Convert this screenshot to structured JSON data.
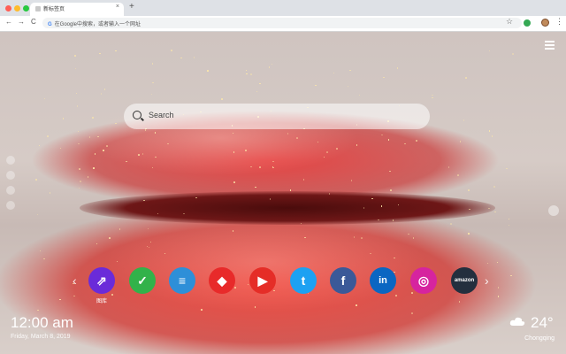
{
  "browser": {
    "tab_title": "新标签页",
    "tab_close": "×",
    "new_tab": "+",
    "address_placeholder": "在Google中搜索，或者输入一个网址",
    "google_glyph": "G",
    "nav": {
      "back": "←",
      "forward": "→",
      "reload": "C"
    },
    "star": "☆",
    "menu": "⋮"
  },
  "search": {
    "placeholder": "Search"
  },
  "apps": [
    {
      "name": "gallery",
      "label": "图库",
      "color": "#6a2bd9",
      "glyph": "⇗"
    },
    {
      "name": "check",
      "label": "",
      "color": "#32b24a",
      "glyph": "✓"
    },
    {
      "name": "notes",
      "label": "",
      "color": "#2e8fd8",
      "glyph": "≡"
    },
    {
      "name": "game",
      "label": "",
      "color": "#e82a2a",
      "glyph": "◆"
    },
    {
      "name": "youtube",
      "label": "",
      "color": "#e52d27",
      "glyph": "▶"
    },
    {
      "name": "twitter",
      "label": "",
      "color": "#1da1f2",
      "glyph": "t"
    },
    {
      "name": "facebook",
      "label": "",
      "color": "#3b5998",
      "glyph": "f"
    },
    {
      "name": "linkedin",
      "label": "",
      "color": "#0a66c2",
      "glyph": "in"
    },
    {
      "name": "instagram",
      "label": "",
      "color": "#d6249f",
      "glyph": "◎"
    },
    {
      "name": "amazon",
      "label": "",
      "color": "#232f3e",
      "glyph": "amazon"
    }
  ],
  "nav_arrows": {
    "prev": "‹",
    "next": "›"
  },
  "clock": {
    "time": "12:00 am",
    "date": "Friday, March 8, 2019"
  },
  "weather": {
    "temp": "24°",
    "city": "Chongqing",
    "icon": "cloud-icon"
  }
}
